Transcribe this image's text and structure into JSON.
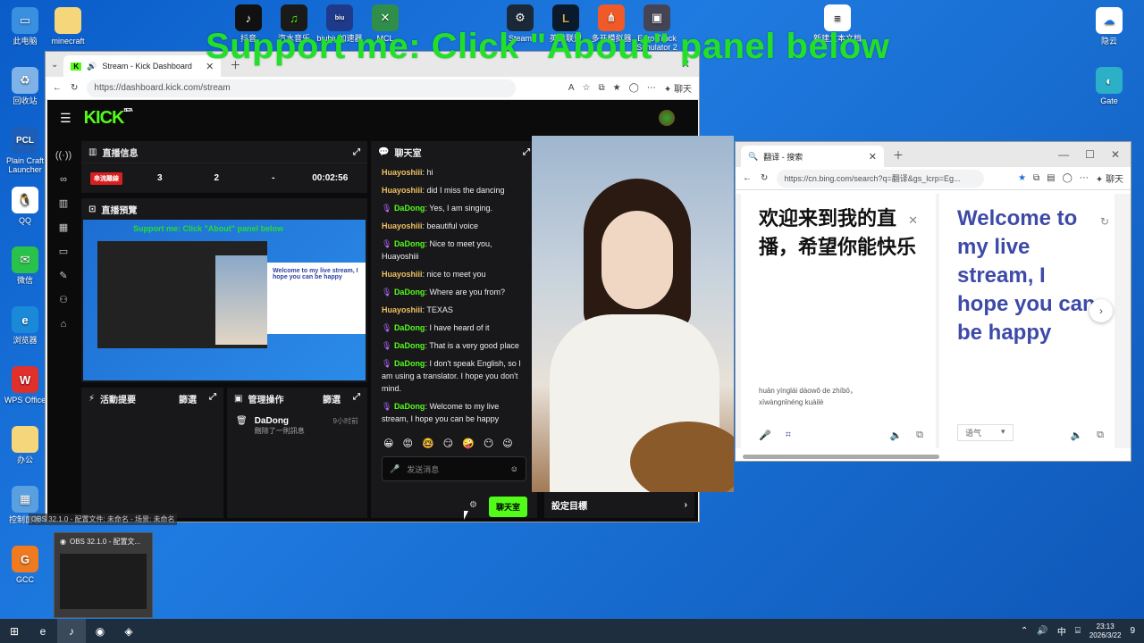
{
  "overlay": {
    "banner": "Support me: Click \"About\" panel below"
  },
  "desktop": {
    "left_icons": [
      {
        "label": "此电脑"
      },
      {
        "label": "回收站"
      },
      {
        "label": "Plain Craft Launcher"
      },
      {
        "label": "QQ"
      },
      {
        "label": "微信"
      },
      {
        "label": "浏览器"
      },
      {
        "label": "WPS Office"
      },
      {
        "label": "办公"
      },
      {
        "label": "控制面板"
      },
      {
        "label": "GCC"
      }
    ],
    "top_icons": [
      {
        "label": "minecraft"
      },
      {
        "label": "抖音"
      },
      {
        "label": "汽水音乐"
      },
      {
        "label": "biubiu加速器"
      },
      {
        "label": "MCL"
      },
      {
        "label": "Steam"
      },
      {
        "label": "英雄联盟"
      },
      {
        "label": "多开模拟器"
      },
      {
        "label": "Euro Truck Simulator 2"
      },
      {
        "label": "新建文本文档"
      }
    ],
    "right_icons": [
      {
        "label": "隐云"
      },
      {
        "label": "Gate"
      }
    ]
  },
  "browser1": {
    "tab_title": "Stream - Kick Dashboard",
    "url": "https://dashboard.kick.com/stream",
    "menu_label": "聊天"
  },
  "kick": {
    "logo": "KICK",
    "logo_sup": "BETA",
    "stream_info": {
      "title": "直播信息",
      "badge": "串流離線",
      "viewers": "3",
      "followers": "2",
      "subs": "-",
      "duration": "00:02:56"
    },
    "preview_title": "直播預覽",
    "preview_banner": "Support me: Click \"About\" panel below",
    "preview_trans_text": "Welcome to my live stream, I hope you can be happy",
    "activity": {
      "title": "活動提要",
      "filter": "篩選"
    },
    "moderation": {
      "title": "管理操作",
      "filter": "篩選",
      "user": "DaDong",
      "desc": "刪除了一則訊息",
      "time": "9小时前"
    },
    "chat": {
      "title": "聊天室",
      "messages": [
        {
          "user": "Huayoshiii",
          "text": ": hi",
          "type": "u1"
        },
        {
          "user": "Huayoshiii",
          "text": ": did I miss the dancing",
          "type": "u1"
        },
        {
          "user": "DaDong",
          "text": ": Yes, I am singing.",
          "type": "u2"
        },
        {
          "user": "Huayoshiii",
          "text": ": beautiful voice",
          "type": "u1"
        },
        {
          "user": "DaDong",
          "text": ": Nice to meet you, Huayoshiii",
          "type": "u2"
        },
        {
          "user": "Huayoshiii",
          "text": ": nice to meet you",
          "type": "u1"
        },
        {
          "user": "DaDong",
          "text": ": Where are you from?",
          "type": "u2"
        },
        {
          "user": "Huayoshiii",
          "text": ": TEXAS",
          "type": "u1"
        },
        {
          "user": "DaDong",
          "text": ": I have heard of it",
          "type": "u2"
        },
        {
          "user": "DaDong",
          "text": ": That is a very good place",
          "type": "u2"
        },
        {
          "user": "DaDong",
          "text": ": I don't speak English, so I am using a translator. I hope you don't mind.",
          "type": "u2"
        },
        {
          "user": "DaDong",
          "text": ": Welcome to my live stream, I hope you can be happy",
          "type": "u2"
        }
      ],
      "input_placeholder": "发送消息",
      "send_label": "聊天室"
    },
    "goal_label": "設定目標"
  },
  "browser2": {
    "tab_title": "翻译 - 搜索",
    "url": "https://cn.bing.com/search?q=翻译&gs_lcrp=Eg...",
    "menu_label": "聊天",
    "source_text": "欢迎来到我的直播，希望你能快乐",
    "target_text": "Welcome to my live stream, I hope you can be happy",
    "pinyin_1": "huān yínglái dàowǒ de zhíbō，",
    "pinyin_2": "xīwàngnǐnéng kuàilè",
    "tone_label": "语气"
  },
  "obs": {
    "label": "OBS 32.1.0 - 配置文件: 未命名 - 场景: 未命名",
    "thumb_title": "OBS 32.1.0 - 配置文..."
  },
  "taskbar": {
    "ime": "中",
    "time": "23:13",
    "date": "2026/3/22",
    "notif": "9"
  }
}
